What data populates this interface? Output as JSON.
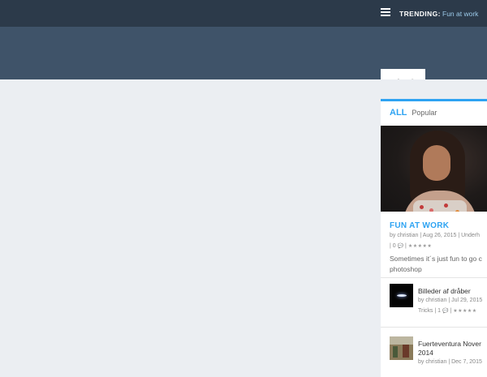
{
  "topbar": {
    "trending_label": "TRENDING:",
    "trending_link": "Fun at work"
  },
  "logo": {
    "text": "Grafingene.dk"
  },
  "sidebar": {
    "tabs": {
      "all": "ALL",
      "popular": "Popular"
    },
    "featured": {
      "title": "FUN AT WORK",
      "meta_line1": "by christian | Aug 26, 2015 | Underh",
      "meta_line2_comments": "| 0",
      "meta_line2_sep": "|",
      "excerpt_line1": "Sometimes it´s just fun to go c",
      "excerpt_line2": "photoshop"
    },
    "items": [
      {
        "title": "Billeder af dråber",
        "meta_line1": "by christian | Jul 29, 2015",
        "meta_line2": "Tricks | 1"
      },
      {
        "title_line1": "Fuerteventura Nover",
        "title_line2": "2014",
        "meta_line1": "by christian | Dec 7, 2015"
      }
    ],
    "stars": "★★★★★"
  },
  "colors": {
    "accent": "#2ea3f2",
    "topbar_bg": "#2c3a4a",
    "header_bg": "#3f5369",
    "page_bg": "#ebeef2"
  }
}
